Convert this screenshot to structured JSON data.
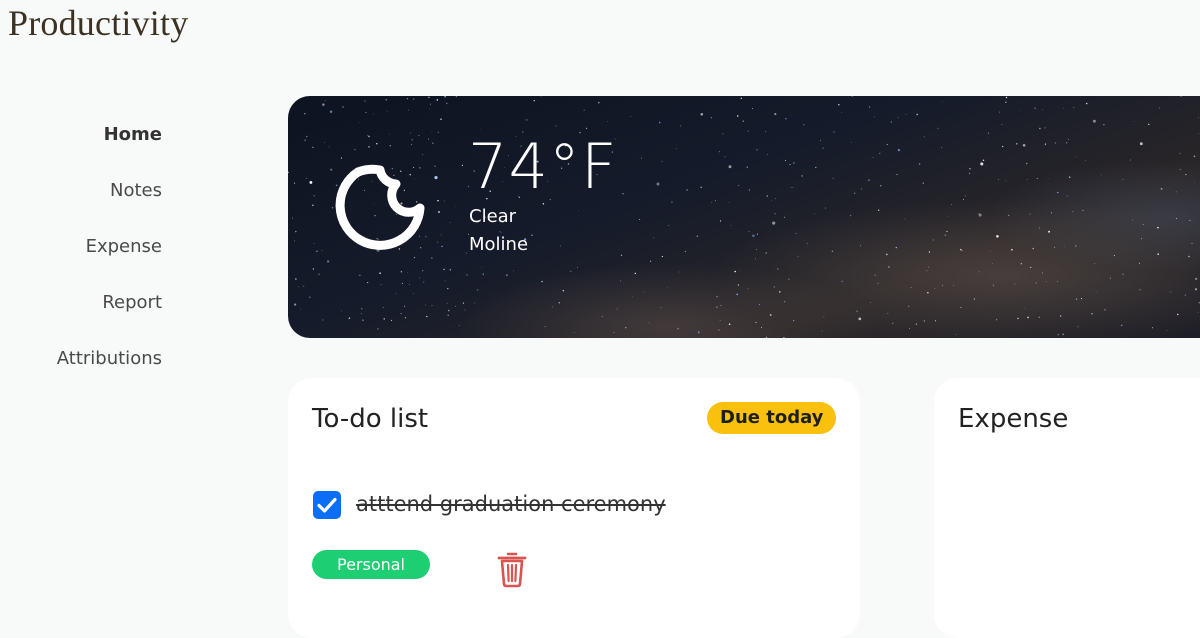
{
  "app": {
    "title": "Productivity"
  },
  "sidebar": {
    "items": [
      {
        "label": "Home",
        "active": true
      },
      {
        "label": "Notes"
      },
      {
        "label": "Expense"
      },
      {
        "label": "Report"
      },
      {
        "label": "Attributions"
      }
    ]
  },
  "weather": {
    "icon": "moon-icon",
    "temperature": "74°F",
    "condition": "Clear",
    "location": "Moline"
  },
  "todo": {
    "title": "To-do list",
    "badge": "Due today",
    "tasks": [
      {
        "text": "atttend graduation ceremony",
        "done": true,
        "tag": "Personal"
      }
    ]
  },
  "expense": {
    "title": "Expense"
  },
  "colors": {
    "badge": "#f9c10e",
    "tag_personal": "#1dcf72",
    "checkbox": "#0b6ef5",
    "trash": "#d9534f"
  }
}
